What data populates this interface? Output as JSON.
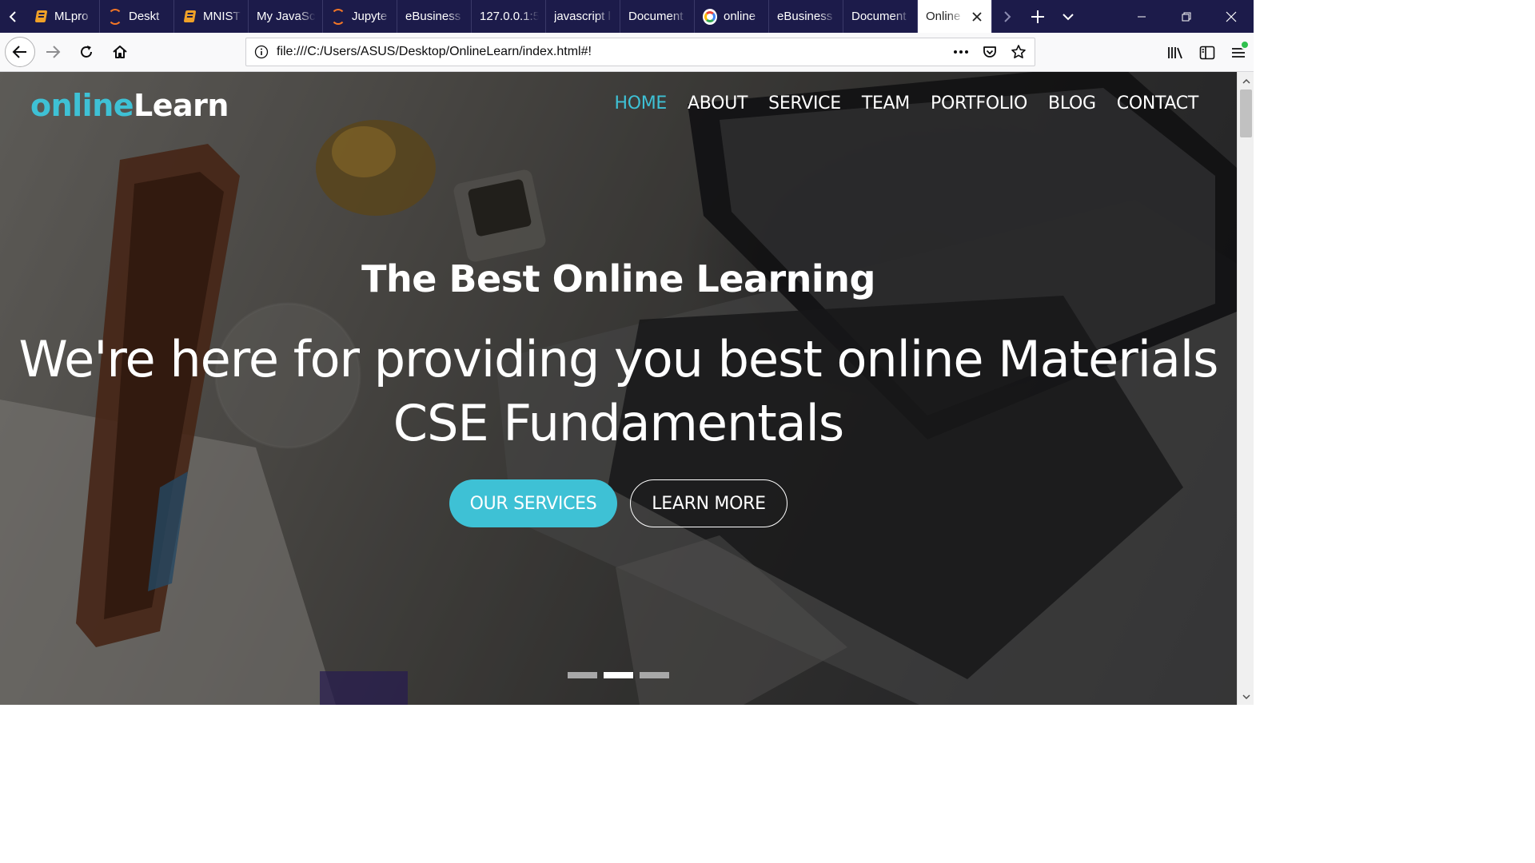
{
  "browser": {
    "tabs": [
      {
        "label": "MLpro",
        "favicon": "book-icon",
        "active": false
      },
      {
        "label": "Deskt",
        "favicon": "jupyter-icon",
        "active": false
      },
      {
        "label": "MNIST",
        "favicon": "book-icon",
        "active": false
      },
      {
        "label": "My JavaSc",
        "favicon": "",
        "active": false
      },
      {
        "label": "Jupyte",
        "favicon": "jupyter-icon",
        "active": false
      },
      {
        "label": "eBusiness",
        "favicon": "",
        "active": false
      },
      {
        "label": "127.0.0.1:5",
        "favicon": "",
        "active": false
      },
      {
        "label": "javascript l",
        "favicon": "",
        "active": false
      },
      {
        "label": "Document",
        "favicon": "",
        "active": false
      },
      {
        "label": "online",
        "favicon": "google-icon",
        "active": false
      },
      {
        "label": "eBusiness",
        "favicon": "",
        "active": false
      },
      {
        "label": "Document",
        "favicon": "",
        "active": false
      },
      {
        "label": "Online",
        "favicon": "",
        "active": true
      }
    ],
    "url": "file:///C:/Users/ASUS/Desktop/OnlineLearn/index.html#!"
  },
  "site": {
    "brand_part1": "online",
    "brand_part2": "Learn",
    "menu": [
      "HOME",
      "ABOUT",
      "SERVICE",
      "TEAM",
      "PORTFOLIO",
      "BLOG",
      "CONTACT"
    ],
    "active_menu": "HOME",
    "hero_kicker": "The Best Online Learning",
    "hero_line1": "We're here for providing you best online Materials",
    "hero_line2": "CSE Fundamentals",
    "btn_primary": "OUR SERVICES",
    "btn_secondary": "LEARN MORE",
    "slides_total": 3,
    "slide_active": 2
  },
  "colors": {
    "accent": "#3ec1d5",
    "tabbar": "#1c1b4a"
  }
}
